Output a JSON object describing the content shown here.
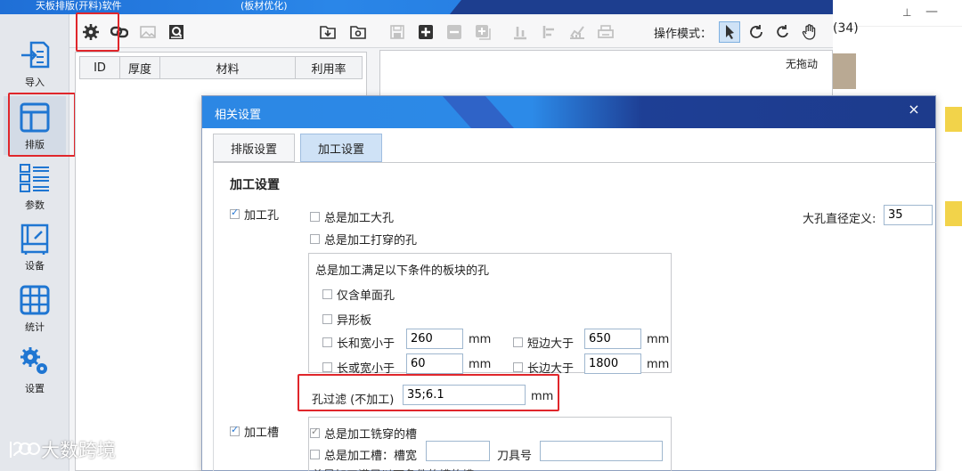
{
  "titlebar": {
    "title_left": "天板排版(开料)软件",
    "title_right": "(板材优化)"
  },
  "sidebar": {
    "items": [
      {
        "label": "导入",
        "icon": "import-icon"
      },
      {
        "label": "排版",
        "icon": "layout-icon"
      },
      {
        "label": "参数",
        "icon": "checklist-icon"
      },
      {
        "label": "设备",
        "icon": "machine-icon"
      },
      {
        "label": "统计",
        "icon": "table-icon"
      },
      {
        "label": "设置",
        "icon": "settings-gears-icon"
      }
    ]
  },
  "toolbar": {
    "op_mode_label": "操作模式："
  },
  "left_panel": {
    "columns": [
      "ID",
      "厚度",
      "材料",
      "利用率"
    ]
  },
  "right_panel": {
    "status": "无拖动"
  },
  "outside": {
    "count_text": "(34)"
  },
  "dialog": {
    "title": "相关设置",
    "close": "×",
    "tabs": [
      "排版设置",
      "加工设置"
    ],
    "section_title": "加工设置",
    "hole": {
      "label": "加工孔",
      "always_large": "总是加工大孔",
      "always_through": "总是加工打穿的孔",
      "large_dia_label": "大孔直径定义:",
      "large_dia_value": "35",
      "cond_title": "总是加工满足以下条件的板块的孔",
      "single_face": "仅含单面孔",
      "shaped": "异形板",
      "len_and_w_label": "长和宽小于",
      "len_and_w_value": "260",
      "len_or_w_label": "长或宽小于",
      "len_or_w_value": "60",
      "short_gt_label": "短边大于",
      "short_gt_value": "650",
      "long_gt_label": "长边大于",
      "long_gt_value": "1800",
      "unit": "mm",
      "filter_label": "孔过滤 (不加工)",
      "filter_value": "35;6.1"
    },
    "slot": {
      "label": "加工槽",
      "always_through": "总是加工铣穿的槽",
      "always_slot": "总是加工槽：槽宽",
      "tool_label": "刀具号",
      "bottom_text": "总是加工满足以下条件的槽的槽"
    }
  },
  "watermark": {
    "text": "大数跨境"
  }
}
